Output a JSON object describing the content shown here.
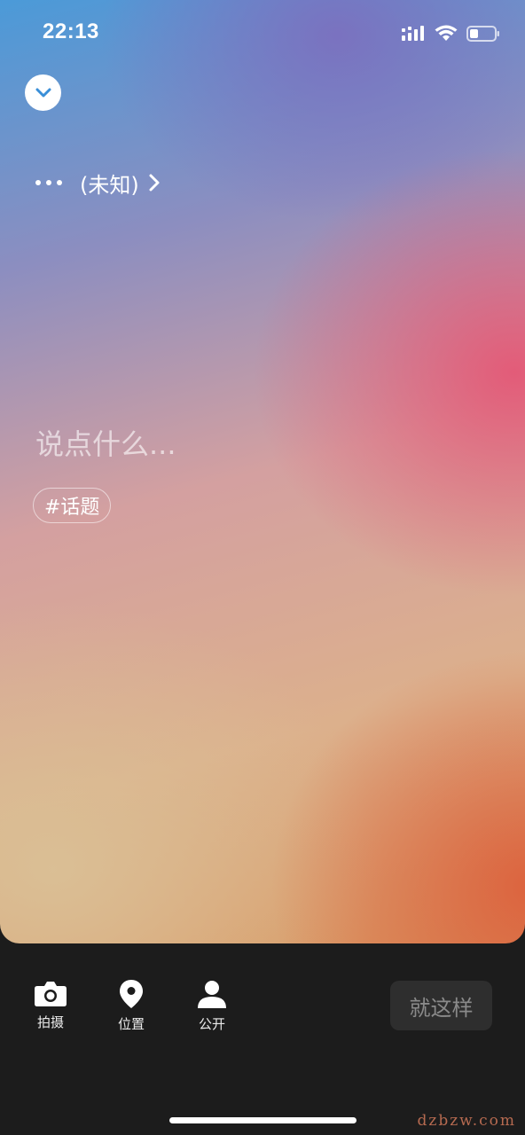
{
  "status": {
    "time": "22:13"
  },
  "audience": {
    "label": "(未知)"
  },
  "composer": {
    "placeholder": "说点什么..."
  },
  "topic_chip": {
    "label": "#话题"
  },
  "toolbar": {
    "camera_label": "拍摄",
    "location_label": "位置",
    "visibility_label": "公开",
    "submit_label": "就这样"
  },
  "watermark": "dzbzw.com",
  "colors": {
    "toolbar_bg": "#1c1c1c",
    "submit_bg": "#2e2e2e",
    "submit_text": "#8a8a8a"
  }
}
